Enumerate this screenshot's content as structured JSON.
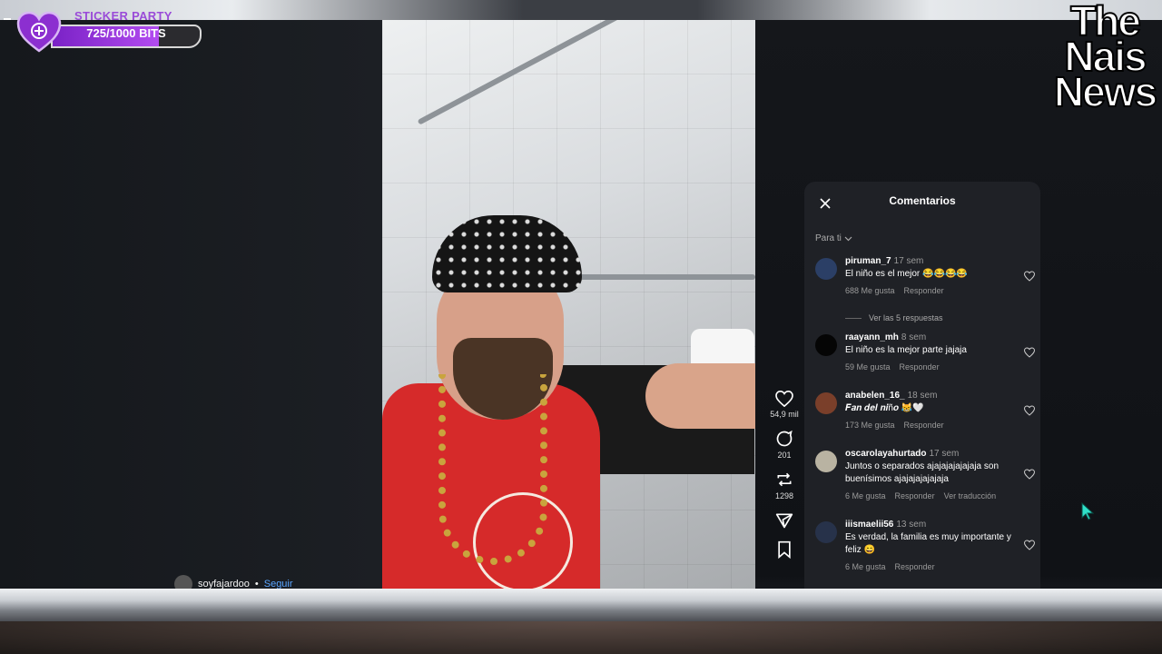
{
  "overlay": {
    "badge_title": "STICKER PARTY",
    "bits_text": "725/1000 BITS",
    "bits_progress": 0.725,
    "brand_lines": [
      "The",
      "Nais",
      "News"
    ]
  },
  "video": {
    "username": "soyfajardoo",
    "separator": "•",
    "follow_label": "Seguir"
  },
  "actions": {
    "likes": "54,9 mil",
    "comments": "201",
    "reposts": "1298"
  },
  "comments_panel": {
    "title": "Comentarios",
    "sort_label": "Para ti",
    "view_replies": "Ver las 5 respuestas",
    "items": [
      {
        "user": "piruman_7",
        "time": "17 sem",
        "text": "El niño es el mejor 😂😂😂😂",
        "likes": "688 Me gusta",
        "reply": "Responder",
        "extra": ""
      },
      {
        "user": "raayann_mh",
        "time": "8 sem",
        "text": "El niño es la mejor parte jajaja",
        "likes": "59 Me gusta",
        "reply": "Responder",
        "extra": ""
      },
      {
        "user": "anabelen_16_",
        "time": "18 sem",
        "text": "𝑭𝒂𝒏 𝒅𝒆𝒍 𝒏𝒊ñ𝒐 😹🤍",
        "likes": "173 Me gusta",
        "reply": "Responder",
        "extra": ""
      },
      {
        "user": "oscarolayahurtado",
        "time": "17 sem",
        "text": "Juntos o separados ajajajajajajaja son buenísimos ajajajajajajaja",
        "likes": "6 Me gusta",
        "reply": "Responder",
        "extra": "Ver traducción"
      },
      {
        "user": "iiismaelii56",
        "time": "13 sem",
        "text": "Es verdad, la familia es muy importante y feliz 😄",
        "likes": "6 Me gusta",
        "reply": "Responder",
        "extra": ""
      }
    ]
  },
  "colors": {
    "panel_bg": "#1f2126",
    "bits_fill": "#9a3ee0",
    "apron_red": "#d62a2a",
    "follow_blue": "#5aa5ff"
  },
  "icons": [
    "plus-heart-icon",
    "close-icon",
    "chevron-down-icon",
    "heart-icon",
    "comment-icon",
    "repost-icon",
    "share-icon",
    "bookmark-icon",
    "cursor-icon"
  ]
}
